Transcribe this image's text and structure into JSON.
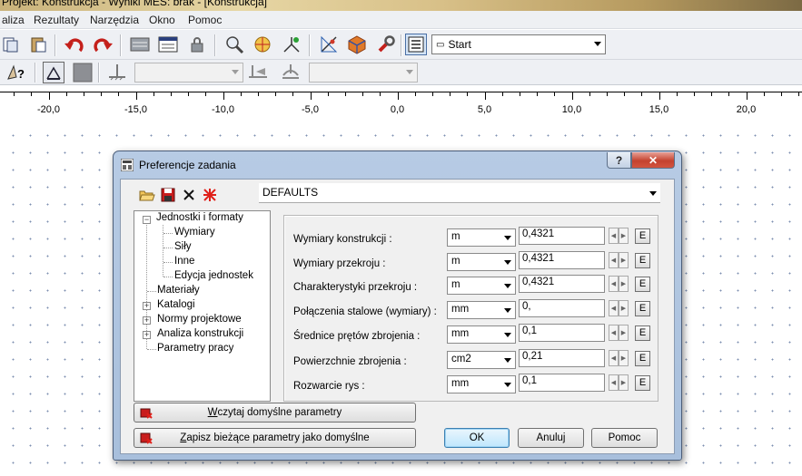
{
  "window": {
    "title": "Projekt: Konstrukcja - Wyniki MES: brak - [Konstrukcja]"
  },
  "menu": {
    "items": [
      "aliza",
      "Rezultaty",
      "Narzędzia",
      "Okno",
      "Pomoc"
    ]
  },
  "toolbar": {
    "layout_combo": "Start",
    "icons": [
      "copy-icon",
      "paste-icon",
      "undo-icon",
      "redo-icon",
      "table-icon",
      "properties-icon",
      "lock-icon",
      "zoom-icon",
      "pan-icon",
      "snap-icon",
      "measure-icon",
      "cube-icon",
      "tools-icon",
      "layout-icon"
    ],
    "row2_icons": [
      "help-pointer-icon",
      "window-icon",
      "section-icon",
      "support-icon",
      "stage-icon",
      "load-icon"
    ]
  },
  "ruler": {
    "labels": [
      "-20,0",
      "-15,0",
      "-10,0",
      "-5,0",
      "0,0",
      "5,0",
      "10,0",
      "15,0",
      "20,0"
    ]
  },
  "dialog": {
    "title": "Preferencje zadania",
    "help_label": "?",
    "close_label": "✕",
    "preset": "DEFAULTS",
    "tree": [
      {
        "label": "Jednostki i formaty",
        "expand": "−"
      },
      {
        "label": "Wymiary"
      },
      {
        "label": "Siły"
      },
      {
        "label": "Inne"
      },
      {
        "label": "Edycja jednostek"
      },
      {
        "label": "Materiały"
      },
      {
        "label": "Katalogi",
        "expand": "+"
      },
      {
        "label": "Normy projektowe",
        "expand": "+"
      },
      {
        "label": "Analiza konstrukcji",
        "expand": "+"
      },
      {
        "label": "Parametry pracy"
      }
    ],
    "rows": [
      {
        "label": "Wymiary konstrukcji :",
        "unit": "m",
        "value": "0,4321",
        "e": "E"
      },
      {
        "label": "Wymiary przekroju :",
        "unit": "m",
        "value": "0,4321",
        "e": "E"
      },
      {
        "label": "Charakterystyki przekroju :",
        "unit": "m",
        "value": "0,4321",
        "e": "E"
      },
      {
        "label": "Połączenia stalowe (wymiary) :",
        "unit": "mm",
        "value": "0,",
        "e": "E"
      },
      {
        "label": "Średnice prętów zbrojenia :",
        "unit": "mm",
        "value": "0,1",
        "e": "E"
      },
      {
        "label": "Powierzchnie zbrojenia :",
        "unit": "cm2",
        "value": "0,21",
        "e": "E"
      },
      {
        "label": "Rozwarcie rys :",
        "unit": "mm",
        "value": "0,1",
        "e": "E"
      }
    ],
    "buttons": {
      "load_defaults": "Wczytaj domyślne parametry",
      "save_defaults": "Zapisz bieżące parametry jako domyślne",
      "ok": "OK",
      "cancel": "Anuluj",
      "help": "Pomoc"
    }
  }
}
